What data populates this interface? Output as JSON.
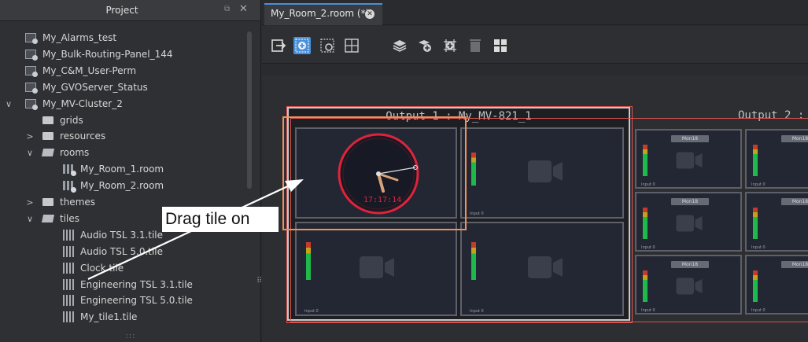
{
  "project_panel": {
    "title": "Project",
    "float_glyph": "⧉",
    "close_glyph": "✕",
    "grip": ":::",
    "split_grip": "⠿",
    "items": [
      {
        "label": "My_Alarms_test",
        "icon": "doc-icon",
        "depth": 0,
        "chevron": ""
      },
      {
        "label": "My_Bulk-Routing-Panel_144",
        "icon": "doc-icon",
        "depth": 0,
        "chevron": ""
      },
      {
        "label": "My_C&M_User-Perm",
        "icon": "doc-icon",
        "depth": 0,
        "chevron": ""
      },
      {
        "label": "My_GVOServer_Status",
        "icon": "doc-icon",
        "depth": 0,
        "chevron": ""
      },
      {
        "label": "My_MV-Cluster_2",
        "icon": "doc-icon",
        "depth": 0,
        "chevron": "∨"
      },
      {
        "label": "grids",
        "icon": "folder-icon",
        "depth": 1,
        "chevron": ""
      },
      {
        "label": "resources",
        "icon": "folder-icon",
        "depth": 1,
        "chevron": ">"
      },
      {
        "label": "rooms",
        "icon": "folder-open-icon",
        "depth": 1,
        "chevron": "∨"
      },
      {
        "label": "My_Room_1.room",
        "icon": "room-icon",
        "depth": 2,
        "chevron": ""
      },
      {
        "label": "My_Room_2.room",
        "icon": "room-icon",
        "depth": 2,
        "chevron": ""
      },
      {
        "label": "themes",
        "icon": "folder-icon",
        "depth": 1,
        "chevron": ">"
      },
      {
        "label": "tiles",
        "icon": "folder-open-icon",
        "depth": 1,
        "chevron": "∨"
      },
      {
        "label": "Audio TSL 3.1.tile",
        "icon": "tile-icon",
        "depth": 2,
        "chevron": ""
      },
      {
        "label": "Audio TSL 5.0.tile",
        "icon": "tile-icon",
        "depth": 2,
        "chevron": ""
      },
      {
        "label": "Clock.tile",
        "icon": "tile-icon",
        "depth": 2,
        "chevron": ""
      },
      {
        "label": "Engineering TSL 3.1.tile",
        "icon": "tile-icon",
        "depth": 2,
        "chevron": ""
      },
      {
        "label": "Engineering TSL 5.0.tile",
        "icon": "tile-icon",
        "depth": 2,
        "chevron": ""
      },
      {
        "label": "My_tile1.tile",
        "icon": "tile-icon",
        "depth": 2,
        "chevron": ""
      }
    ]
  },
  "editor": {
    "tab_label": "My_Room_2.room (*)",
    "tab_close_glyph": "✕",
    "toolbar": [
      {
        "name": "exit-icon"
      },
      {
        "name": "add-tile-icon",
        "active": true
      },
      {
        "name": "link-tile-icon"
      },
      {
        "name": "grid-icon"
      },
      {
        "name": "layers-icon"
      },
      {
        "name": "layer-add-icon"
      },
      {
        "name": "grid-add-icon"
      },
      {
        "name": "trash-icon"
      },
      {
        "name": "layout-icon"
      }
    ],
    "output1_title": "Output 1 : My_MV-821_1",
    "output2_title": "Output 2 :",
    "clock_time": "17:17:14",
    "input_label": "Input 0",
    "mon_label": "Mon18"
  },
  "callout": {
    "text": "Drag tile on"
  },
  "colors": {
    "accent_blue": "#4a90d9",
    "selection_red": "#d9534f",
    "drop_orange": "#f0905a",
    "clock_red": "#e0233b"
  }
}
